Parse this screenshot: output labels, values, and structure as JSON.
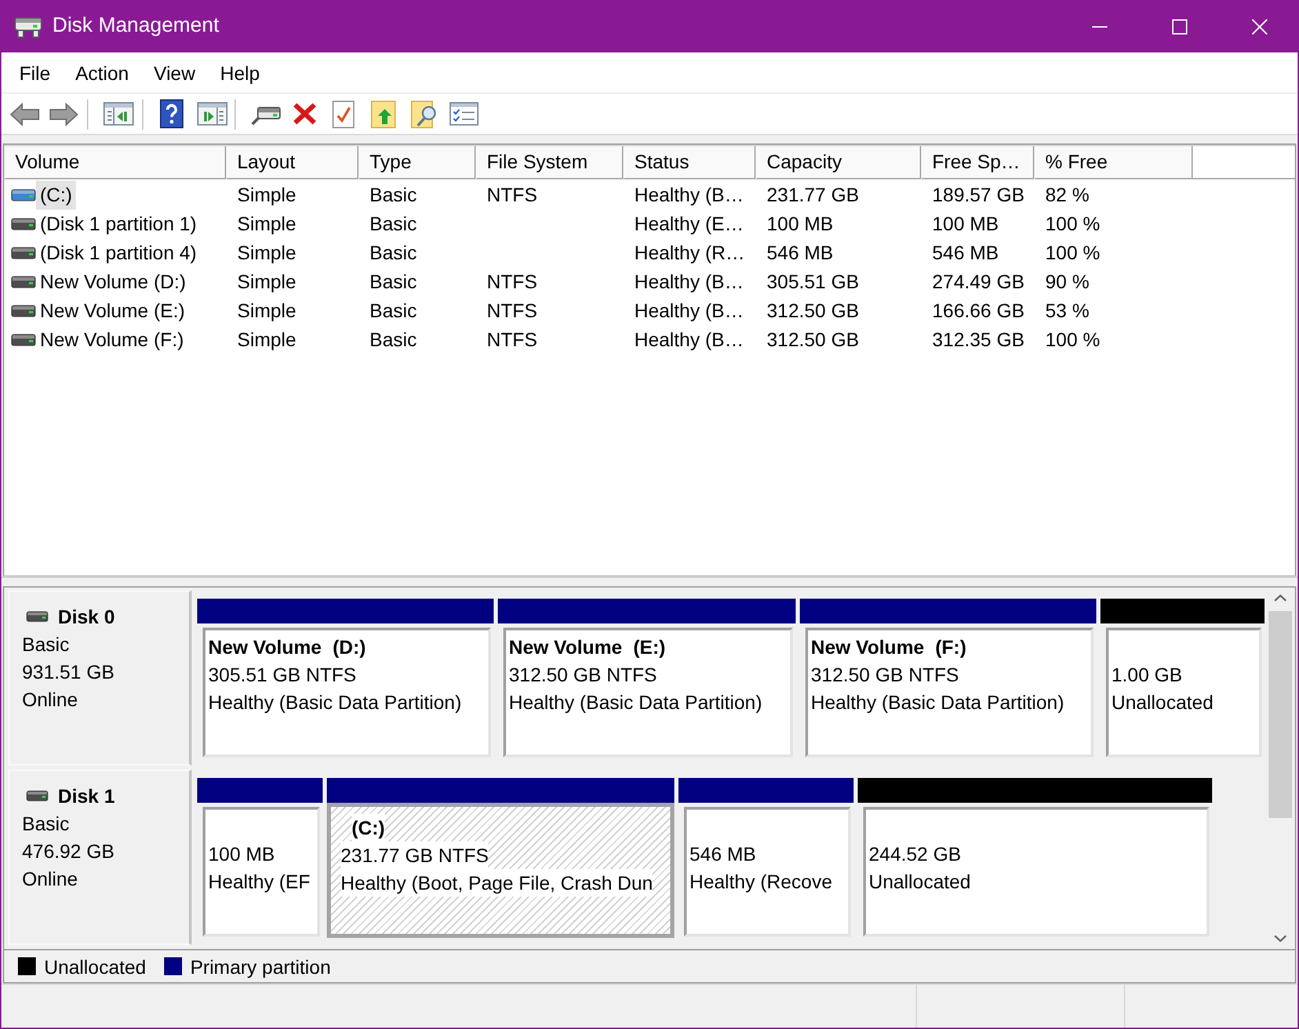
{
  "window": {
    "title": "Disk Management"
  },
  "menu": [
    "File",
    "Action",
    "View",
    "Help"
  ],
  "volume_table": {
    "columns": [
      "Volume",
      "Layout",
      "Type",
      "File System",
      "Status",
      "Capacity",
      "Free Sp…",
      "% Free"
    ],
    "rows": [
      {
        "kind": "boot",
        "selected": true,
        "volume": "(C:)",
        "layout": "Simple",
        "type": "Basic",
        "file_system": "NTFS",
        "status": "Healthy (B…",
        "capacity": "231.77 GB",
        "free_space": "189.57 GB",
        "percent_free": "82 %"
      },
      {
        "kind": "volume",
        "selected": false,
        "volume": "(Disk 1 partition 1)",
        "layout": "Simple",
        "type": "Basic",
        "status": "Healthy (E…",
        "capacity": "100 MB",
        "free_space": "100 MB",
        "percent_free": "100 %"
      },
      {
        "kind": "volume",
        "selected": false,
        "volume": "(Disk 1 partition 4)",
        "layout": "Simple",
        "type": "Basic",
        "status": "Healthy (R…",
        "capacity": "546 MB",
        "free_space": "546 MB",
        "percent_free": "100 %"
      },
      {
        "kind": "volume",
        "selected": false,
        "volume": "New Volume (D:)",
        "layout": "Simple",
        "type": "Basic",
        "file_system": "NTFS",
        "status": "Healthy (B…",
        "capacity": "305.51 GB",
        "free_space": "274.49 GB",
        "percent_free": "90 %"
      },
      {
        "kind": "volume",
        "selected": false,
        "volume": "New Volume (E:)",
        "layout": "Simple",
        "type": "Basic",
        "file_system": "NTFS",
        "status": "Healthy (B…",
        "capacity": "312.50 GB",
        "free_space": "166.66 GB",
        "percent_free": "53 %"
      },
      {
        "kind": "volume",
        "selected": false,
        "volume": "New Volume (F:)",
        "layout": "Simple",
        "type": "Basic",
        "file_system": "NTFS",
        "status": "Healthy (B…",
        "capacity": "312.50 GB",
        "free_space": "312.35 GB",
        "percent_free": "100 %"
      }
    ]
  },
  "disks": [
    {
      "name": "Disk 0",
      "type": "Basic",
      "size": "931.51 GB",
      "status": "Online",
      "partitions": [
        {
          "kind": "primary",
          "selected": false,
          "name": "New Volume",
          "letter": "(D:)",
          "size": "305.51 GB NTFS",
          "status": "Healthy (Basic Data Partition)"
        },
        {
          "kind": "primary",
          "selected": false,
          "name": "New Volume",
          "letter": "(E:)",
          "size": "312.50 GB NTFS",
          "status": "Healthy (Basic Data Partition)"
        },
        {
          "kind": "primary",
          "selected": false,
          "name": "New Volume",
          "letter": "(F:)",
          "size": "312.50 GB NTFS",
          "status": "Healthy (Basic Data Partition)"
        },
        {
          "kind": "unallocated",
          "selected": false,
          "size": "1.00 GB",
          "status": "Unallocated"
        }
      ]
    },
    {
      "name": "Disk 1",
      "type": "Basic",
      "size": "476.92 GB",
      "status": "Online",
      "partitions": [
        {
          "kind": "primary",
          "selected": false,
          "size": "100 MB",
          "status": "Healthy (EF"
        },
        {
          "kind": "primary",
          "selected": true,
          "letter": "(C:)",
          "size": "231.77 GB NTFS",
          "status": "Healthy (Boot, Page File, Crash Dun"
        },
        {
          "kind": "primary",
          "selected": false,
          "size": "546 MB",
          "status": "Healthy (Recove"
        },
        {
          "kind": "unallocated",
          "selected": false,
          "size": "244.52 GB",
          "status": "Unallocated"
        }
      ]
    }
  ],
  "legend": [
    {
      "label": "Unallocated",
      "color": "#000000"
    },
    {
      "label": "Primary partition",
      "color": "#000080"
    }
  ]
}
